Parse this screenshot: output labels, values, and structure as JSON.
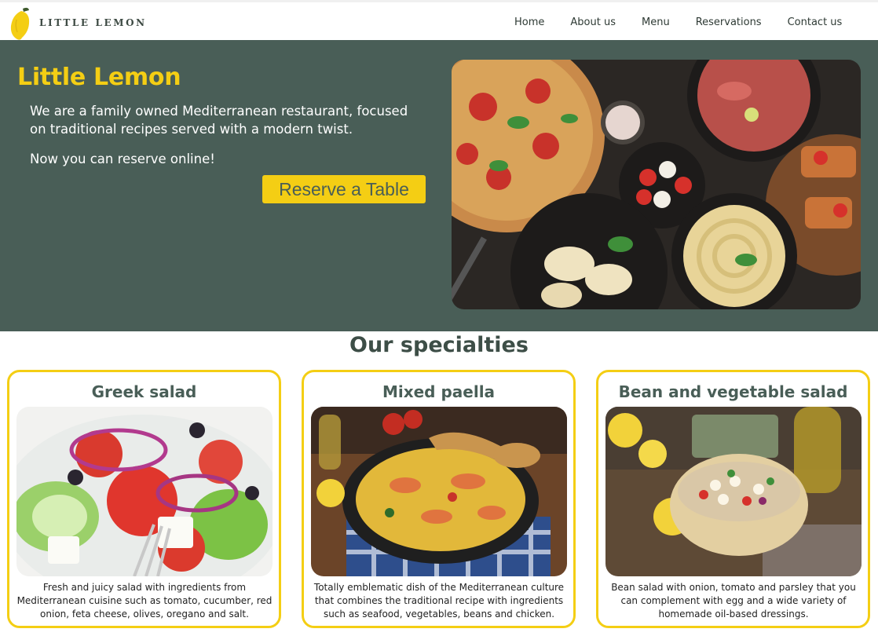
{
  "brand": {
    "name": "LITTLE LEMON"
  },
  "nav": {
    "items": [
      "Home",
      "About us",
      "Menu",
      "Reservations",
      "Contact us"
    ]
  },
  "hero": {
    "title": "Little Lemon",
    "description": "We are a family owned Mediterranean restaurant, focused on traditional recipes served with a modern twist.",
    "reserve_online": "Now you can reserve online!",
    "button_label": "Reserve a Table"
  },
  "specialties": {
    "title": "Our specialties",
    "items": [
      {
        "name": "Greek salad",
        "description": "Fresh and juicy salad with ingredients from Mediterranean cuisine such as tomato, cucumber, red onion, feta cheese, olives, oregano and salt."
      },
      {
        "name": "Mixed paella",
        "description": "Totally emblematic dish of the Mediterranean culture that combines the traditional recipe with ingredients such as seafood, vegetables, beans and chicken."
      },
      {
        "name": "Bean and vegetable salad",
        "description": "Bean salad with onion, tomato and parsley that you can complement with egg and a wide variety of homemade oil-based dressings."
      }
    ]
  },
  "colors": {
    "primary_green": "#495e57",
    "primary_yellow": "#f4ce14"
  }
}
